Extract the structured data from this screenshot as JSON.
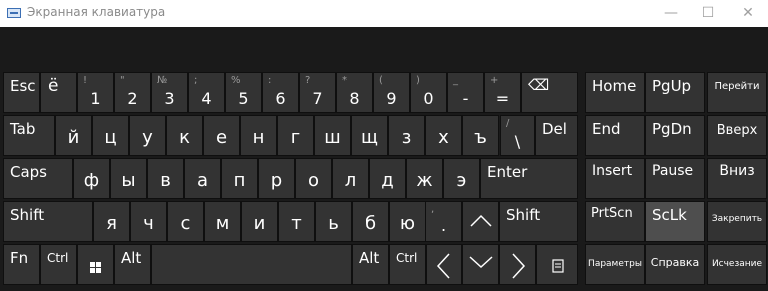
{
  "window": {
    "title": "Экранная клавиатура",
    "minimize": "—",
    "maximize": "☐",
    "close": "✕"
  },
  "keys": {
    "esc": "Esc",
    "yo": "ё",
    "backspace": "⌫",
    "digits": [
      "1",
      "2",
      "3",
      "4",
      "5",
      "6",
      "7",
      "8",
      "9",
      "0",
      "-",
      "="
    ],
    "shift_syms": [
      "!",
      "\"",
      "№",
      ";",
      "%",
      ":",
      "?",
      "*",
      "(",
      ")",
      "_",
      "+"
    ],
    "tab": "Tab",
    "row_q": [
      "й",
      "ц",
      "у",
      "к",
      "е",
      "н",
      "г",
      "ш",
      "щ",
      "з",
      "х",
      "ъ"
    ],
    "slash_top": "/",
    "slash_bottom": "\\",
    "del": "Del",
    "caps": "Caps",
    "row_a": [
      "ф",
      "ы",
      "в",
      "а",
      "п",
      "р",
      "о",
      "л",
      "д",
      "ж",
      "э"
    ],
    "enter": "Enter",
    "shift": "Shift",
    "row_z": [
      "я",
      "ч",
      "с",
      "м",
      "и",
      "т",
      "ь",
      "б",
      "ю"
    ],
    "comma_top": ",",
    "dot": ".",
    "fn": "Fn",
    "ctrl": "Ctrl",
    "alt": "Alt",
    "up_icon": "caret-up-icon",
    "down_icon": "caret-down-icon",
    "left_icon": "caret-left-icon",
    "right_icon": "caret-right-icon",
    "menu_icon": "menu-key-icon",
    "windows_icon": "windows-icon"
  },
  "nav": {
    "home": "Home",
    "pgup": "PgUp",
    "goto": "Перейти",
    "end": "End",
    "pgdn": "PgDn",
    "up": "Вверх",
    "insert": "Insert",
    "pause": "Pause",
    "down": "Вниз",
    "prtscn": "PrtScn",
    "sclk": "ScLk",
    "dock": "Закрепить",
    "options": "Параметры",
    "help": "Справка",
    "fade": "Исчезание"
  },
  "colors": {
    "key": "#333333",
    "key_active": "#4e4e4e",
    "background": "#1a1a1a",
    "text": "#ffffff"
  }
}
